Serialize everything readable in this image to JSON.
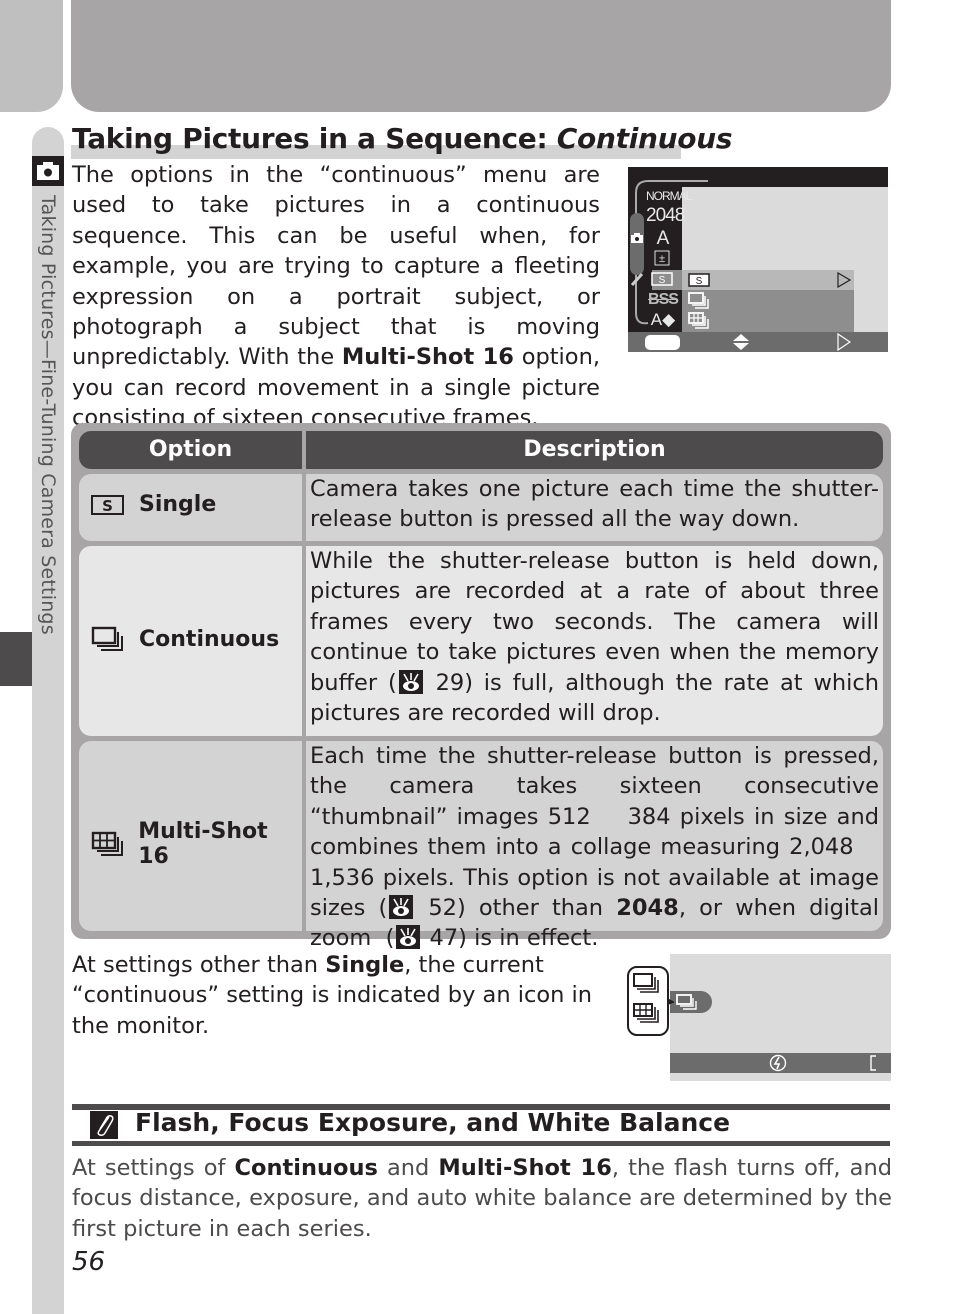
{
  "side_tab": {
    "label": "Taking Pictures—Fine-Tuning Camera Settings",
    "icon": "camera-icon"
  },
  "title": {
    "main": "Taking Pictures in a Sequence: ",
    "emphasis": "Continuous"
  },
  "intro": {
    "part1": "The options in the “continuous” menu are used to take pictures in a continuous sequence.  This can be useful when, for example, you are trying to capture a fleeting expression on a portrait subject, or photograph a subject that is moving unpredictably.  With the ",
    "bold": "Multi-Shot 16",
    "part2": " option, you can record movement in a single picture consisting of sixteen consecutive frames."
  },
  "camera_menu": {
    "left_labels": [
      "NORMAL",
      "2048",
      "A",
      "±",
      "S",
      "BSS",
      "A◆"
    ],
    "options": [
      {
        "icon": "single-frame-icon",
        "label": "S",
        "selected": true
      },
      {
        "icon": "continuous-icon",
        "selected": false
      },
      {
        "icon": "multi-shot-icon",
        "selected": false
      }
    ],
    "bottom_icons": [
      "menu-button",
      "up-down-arrows-icon",
      "right-arrow-icon"
    ]
  },
  "table": {
    "headers": {
      "option": "Option",
      "description": "Description"
    },
    "rows": [
      {
        "icon": "single-frame-icon",
        "option": "Single",
        "description": "Camera takes one picture each time the shutter-release button is pressed all the way down."
      },
      {
        "icon": "continuous-icon",
        "option": "Continuous",
        "description_a": "While the shutter-release button is held down, pictures are recorded at a rate of about three frames every two seconds.  The camera will continue to take pictures even when the memory buffer (",
        "ref": "29",
        "description_b": ") is full, although the rate at which pictures are recorded will drop."
      },
      {
        "icon": "multi-shot-icon",
        "option": "Multi-Shot 16",
        "description_a": "Each time the shutter-release button is pressed, the camera takes sixteen consecutive “thumbnail” images 512    384 pixels in size and combines them into a collage measuring 2,048    1,536 pixels.  This option is not available at image sizes (",
        "ref1": "52",
        "description_b": ") other than ",
        "bold": "2048",
        "description_c": ", or when digital zoom  (",
        "ref2": "47",
        "description_d": ") is in effect."
      }
    ]
  },
  "para2": {
    "part1": "At settings other than ",
    "bold": "Single",
    "part2": ", the current “continuous” setting is indicated by an icon in the monitor."
  },
  "monitor": {
    "indicator_icon": "continuous-icon",
    "callout_icons": [
      "continuous-icon",
      "multi-shot-icon"
    ],
    "bar_icons": [
      "flash-off-icon",
      "focus-bracket-icon"
    ]
  },
  "note": {
    "title": "Flash, Focus Exposure, and White Balance",
    "part1": "At settings of ",
    "bold1": "Continuous",
    "part2": " and ",
    "bold2": "Multi-Shot 16",
    "part3": ", the flash turns off, and focus distance, exposure, and auto white balance are determined by the first picture in each series."
  },
  "page_number": "56"
}
